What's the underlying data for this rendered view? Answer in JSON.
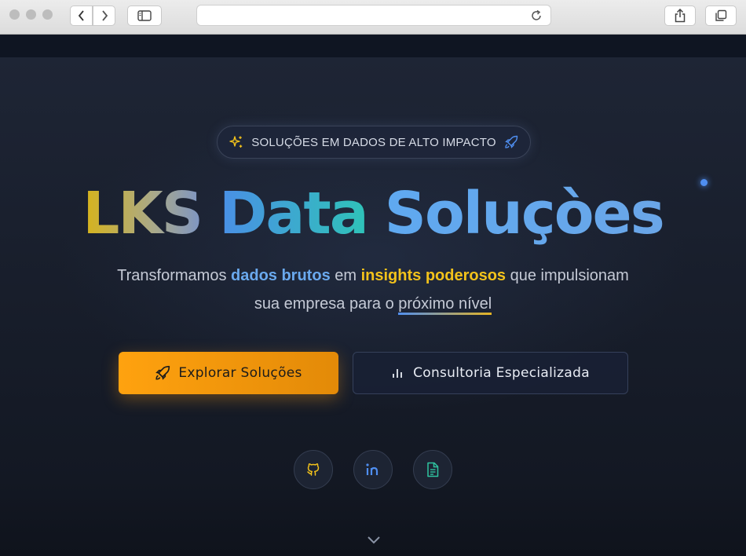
{
  "browser": {
    "icons": [
      "back-icon",
      "forward-icon",
      "sidebar-icon",
      "reload-icon",
      "share-icon",
      "tabs-icon"
    ]
  },
  "hero": {
    "badge": {
      "text": "SOLUÇÕES EM DADOS DE ALTO IMPACTO",
      "left_icon": "sparkles-icon",
      "right_icon": "rocket-icon"
    },
    "title": {
      "word1": "LKS",
      "word2": "Data",
      "word3": "Soluçòes"
    },
    "subtitle": {
      "part1": "Transformamos ",
      "highlight1": "dados brutos",
      "part2": " em ",
      "highlight2": "insights poderosos",
      "part3": " que impulsionam",
      "line2_prefix": "sua empresa para o ",
      "line2_underlined": "próximo nível"
    },
    "buttons": {
      "primary": {
        "label": "Explorar Soluções",
        "icon": "rocket-icon"
      },
      "secondary": {
        "label": "Consultoria Especializada",
        "icon": "bar-chart-icon"
      }
    },
    "social": [
      {
        "name": "github",
        "icon": "github-icon",
        "color": "#f2c21b"
      },
      {
        "name": "linkedin",
        "icon": "linkedin-icon",
        "color": "#4f8ef0"
      },
      {
        "name": "document",
        "icon": "document-icon",
        "color": "#2fc3a0"
      }
    ],
    "scroll_icon": "chevron-down-icon"
  },
  "colors": {
    "accent_orange": "#ffa20f",
    "accent_yellow": "#f2c21b",
    "accent_blue": "#4f8ef0",
    "accent_teal": "#2fc3b8",
    "background": "#141a26"
  }
}
